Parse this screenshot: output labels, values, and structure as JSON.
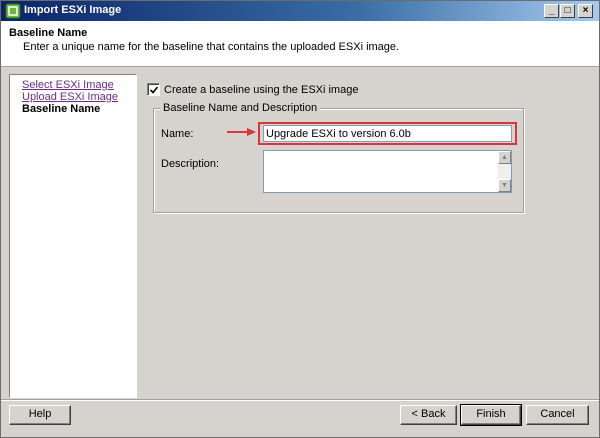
{
  "window": {
    "title": "Import ESXi Image",
    "controls": {
      "minimize": "_",
      "maximize": "□",
      "close": "×"
    }
  },
  "header": {
    "title": "Baseline Name",
    "subtitle": "Enter a unique name for the baseline that contains the uploaded ESXi image."
  },
  "nav": {
    "items": [
      {
        "label": "Select ESXi Image",
        "state": "link"
      },
      {
        "label": "Upload ESXi Image",
        "state": "link"
      },
      {
        "label": "Baseline Name",
        "state": "current"
      }
    ]
  },
  "form": {
    "create_baseline_label": "Create a baseline using the ESXi image",
    "create_baseline_checked": true,
    "group_legend": "Baseline Name and Description",
    "name_label": "Name:",
    "name_value": "Upgrade ESXi to version 6.0b",
    "description_label": "Description:",
    "description_value": ""
  },
  "annotation": {
    "highlight_color": "#d9353a"
  },
  "footer": {
    "help_label": "Help",
    "back_label": "< Back",
    "finish_label": "Finish",
    "cancel_label": "Cancel"
  },
  "colors": {
    "titlebar_start": "#0a246a",
    "dialog_background": "#d6d3ce",
    "link_color": "#6a2c8a"
  }
}
